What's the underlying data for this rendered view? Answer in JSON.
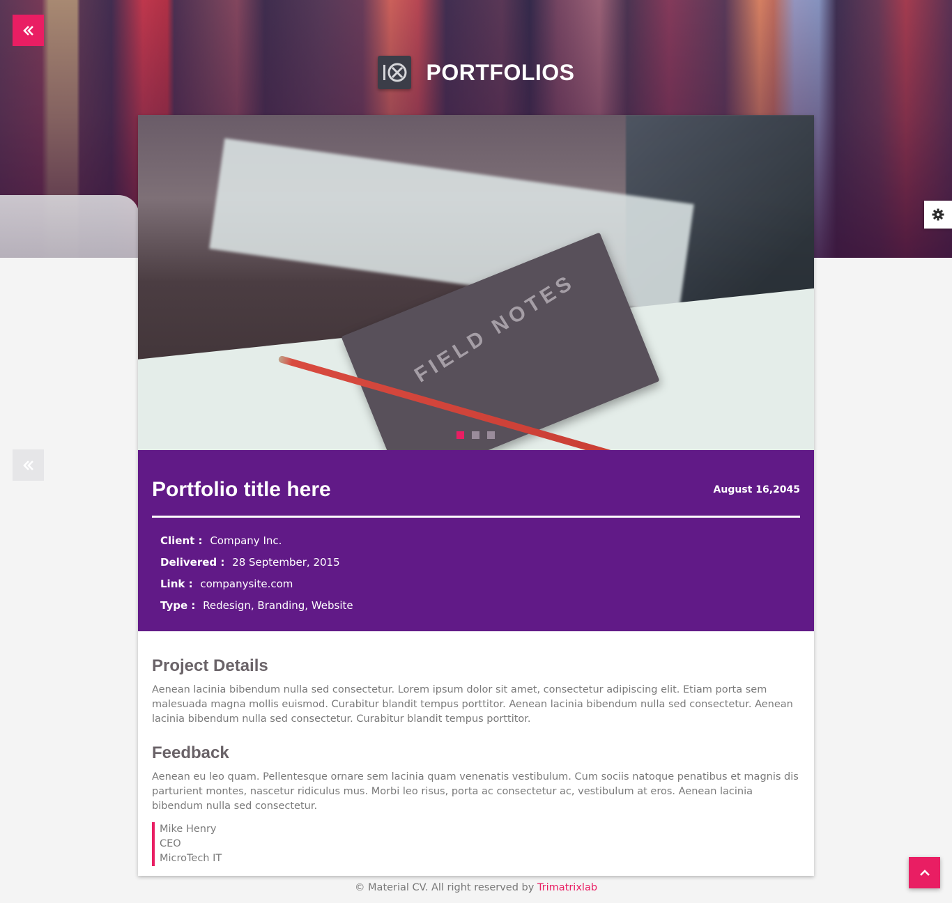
{
  "header": {
    "title": "PORTFOLIOS",
    "logo_icon": "logo-circle-x-icon"
  },
  "nav": {
    "back_icon": "double-chevron-left-icon",
    "settings_icon": "gear-icon",
    "scroll_top_icon": "chevron-up-icon"
  },
  "slider": {
    "dots": 3,
    "active_index": 0,
    "image_text": "FIELD NOTES"
  },
  "portfolio": {
    "title": "Portfolio title here",
    "date": "August 16,2045",
    "meta": [
      {
        "label": "Client :",
        "value": "Company Inc."
      },
      {
        "label": "Delivered :",
        "value": "28 September, 2015"
      },
      {
        "label": "Link :",
        "value": "companysite.com"
      },
      {
        "label": "Type :",
        "value": "Redesign, Branding, Website"
      }
    ]
  },
  "details": {
    "project_heading": "Project Details",
    "project_body": "Aenean lacinia bibendum nulla sed consectetur. Lorem ipsum dolor sit amet, consectetur adipiscing elit. Etiam porta sem malesuada magna mollis euismod. Curabitur blandit tempus porttitor. Aenean lacinia bibendum nulla sed consectetur. Aenean lacinia bibendum nulla sed consectetur. Curabitur blandit tempus porttitor.",
    "feedback_heading": "Feedback",
    "feedback_body": "Aenean eu leo quam. Pellentesque ornare sem lacinia quam venenatis vestibulum. Cum sociis natoque penatibus et magnis dis parturient montes, nascetur ridiculus mus. Morbi leo risus, porta ac consectetur ac, vestibulum at eros. Aenean lacinia bibendum nulla sed consectetur.",
    "quote": {
      "name": "Mike Henry",
      "role": "CEO",
      "company": "MicroTech IT"
    }
  },
  "footer": {
    "text": "© Material CV. All right reserved by ",
    "brand": "Trimatrixlab"
  },
  "colors": {
    "accent": "#e91e63",
    "info_bg": "#611a87"
  }
}
